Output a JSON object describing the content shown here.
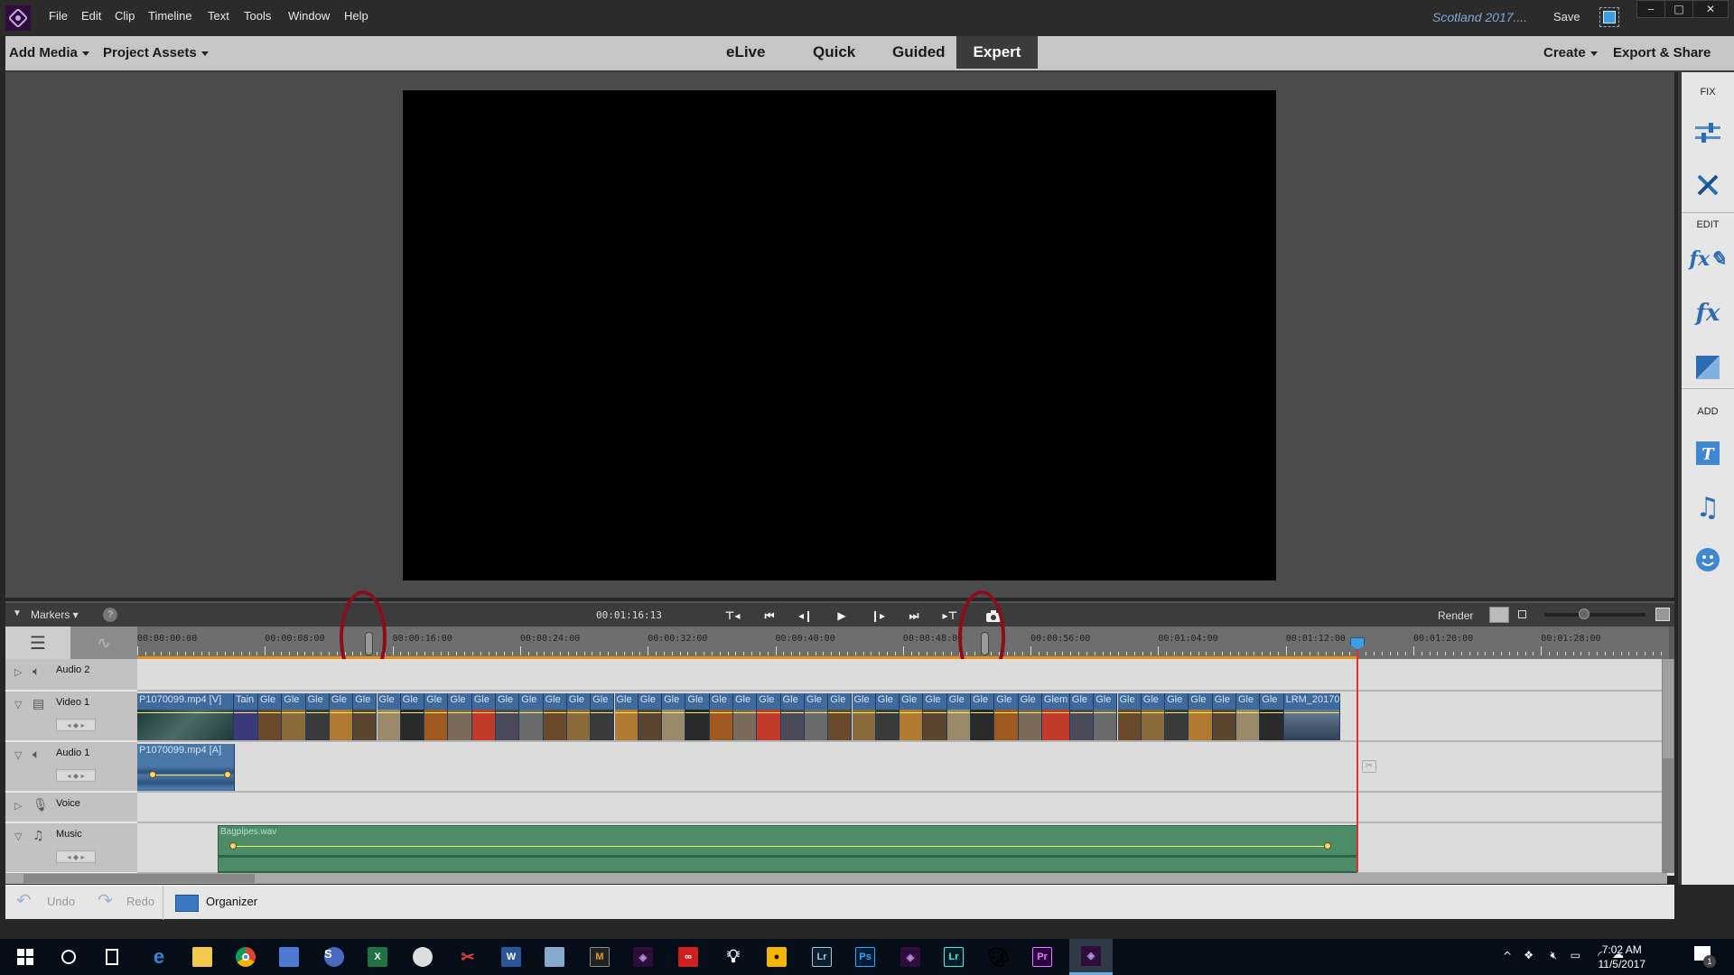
{
  "app": {
    "project_name": "Scotland 2017....",
    "save_label": "Save",
    "menu": [
      "File",
      "Edit",
      "Clip",
      "Timeline",
      "Text",
      "Tools",
      "Window",
      "Help"
    ],
    "window_controls": {
      "minimize": "‒",
      "maximize": "□",
      "close": "✕"
    }
  },
  "modebar": {
    "add_media": "Add Media",
    "project_assets": "Project Assets",
    "tabs": [
      {
        "label": "eLive",
        "active": false
      },
      {
        "label": "Quick",
        "active": false
      },
      {
        "label": "Guided",
        "active": false
      },
      {
        "label": "Expert",
        "active": true
      }
    ],
    "create": "Create",
    "export_share": "Export & Share"
  },
  "right_panel": {
    "sections": [
      {
        "label": "FIX",
        "icons": [
          "adjustments-sliders-icon",
          "tools-wrench-screwdriver-icon"
        ]
      },
      {
        "label": "EDIT",
        "icons": [
          "fx-edit-icon",
          "effects-fx-icon",
          "transitions-icon"
        ]
      },
      {
        "label": "ADD",
        "icons": [
          "titles-text-icon",
          "music-note-icon",
          "graphics-smiley-icon"
        ]
      }
    ]
  },
  "timeline_toolbar": {
    "markers_label": "Markers",
    "help": "?",
    "timecode": "00:01:16:13",
    "render_label": "Render",
    "zoom_level_fraction": 0.38
  },
  "ruler": {
    "labels": [
      "00:00:00:00",
      "00:00:08:00",
      "00:00:16:00",
      "00:00:24:00",
      "00:00:32:00",
      "00:00:40:00",
      "00:00:48:00",
      "00:00:56:00",
      "00:01:04:00",
      "00:01:12:00",
      "00:01:20:00",
      "00:01:28:00"
    ]
  },
  "tracks": [
    {
      "name": "Audio 2",
      "type": "audio",
      "expanded": false
    },
    {
      "name": "Video 1",
      "type": "video",
      "expanded": true
    },
    {
      "name": "Audio 1",
      "type": "audio",
      "expanded": true
    },
    {
      "name": "Voice",
      "type": "voice",
      "expanded": false
    },
    {
      "name": "Music",
      "type": "music",
      "expanded": true
    }
  ],
  "video_clips": {
    "first": "P1070099.mp4 [V]",
    "second": "Tain",
    "repeated": "Gle",
    "special": "Glem",
    "last": "LRM_20170"
  },
  "audio_clip": "P1070099.mp4 [A]",
  "music_clip": "Bagpipes.wav",
  "bottombar": {
    "undo": "Undo",
    "redo": "Redo",
    "organizer": "Organizer"
  },
  "taskbar": {
    "apps": [
      "start",
      "cortana",
      "task-view",
      "edge",
      "file-explorer",
      "chrome",
      "network-utility",
      "sync-app",
      "excel",
      "compass-app",
      "snipping-tool",
      "word",
      "notepad",
      "film-app",
      "premiere-elements-organizer",
      "creative-cloud",
      "tips",
      "photo-app",
      "lightroom",
      "photoshop",
      "premiere-elements",
      "lightroom-cc",
      "paint",
      "premiere-pro",
      "premiere-elements-active"
    ],
    "time": "7:02 AM",
    "date": "11/5/2017",
    "notification_count": "1"
  }
}
